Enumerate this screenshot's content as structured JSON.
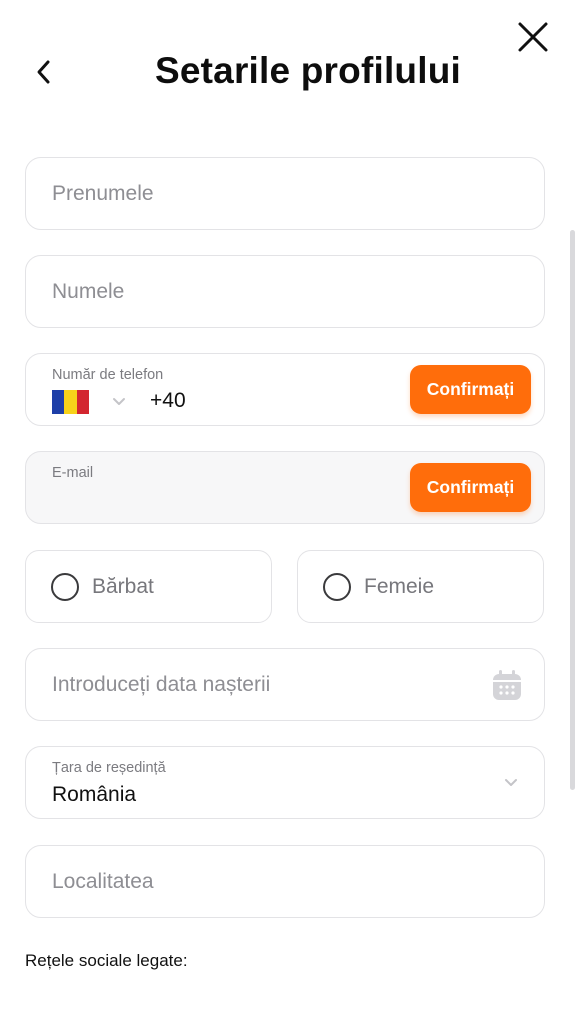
{
  "header": {
    "title": "Setarile profilului"
  },
  "form": {
    "first_name": {
      "placeholder": "Prenumele"
    },
    "last_name": {
      "placeholder": "Numele"
    },
    "phone": {
      "label": "Număr de telefon",
      "prefix": "+40",
      "country_flag": "romania-flag",
      "confirm_label": "Confirmați"
    },
    "email": {
      "label": "E-mail",
      "value": "",
      "confirm_label": "Confirmați"
    },
    "gender": {
      "options": [
        "Bărbat",
        "Femeie"
      ]
    },
    "birth_date": {
      "placeholder": "Introduceți data nașterii"
    },
    "country": {
      "label": "Țara de reședință",
      "value": "România"
    },
    "city": {
      "placeholder": "Localitatea"
    }
  },
  "social": {
    "section_label": "Rețele sociale legate:"
  },
  "colors": {
    "accent": "#ff6d0b",
    "border": "#e3e3e6",
    "placeholder": "#8e8e93"
  },
  "icons": {
    "close": "close-icon",
    "back": "chevron-left-icon",
    "calendar": "calendar-icon",
    "dropdown": "chevron-down-icon"
  }
}
